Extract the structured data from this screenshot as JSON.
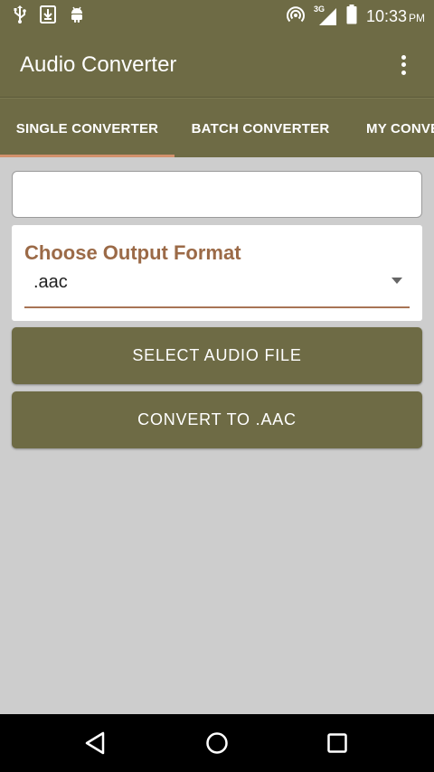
{
  "status_bar": {
    "time": "10:33",
    "ampm": "PM",
    "network": "3G",
    "icons": [
      "usb-icon",
      "download-icon",
      "android-icon",
      "hotspot-icon",
      "signal-icon",
      "battery-icon"
    ]
  },
  "app_bar": {
    "title": "Audio Converter",
    "menu_icon": "overflow-menu-icon"
  },
  "tabs": [
    {
      "label": "SINGLE CONVERTER",
      "active": true
    },
    {
      "label": "BATCH CONVERTER",
      "active": false
    },
    {
      "label": "MY CONVERTED",
      "active": false
    }
  ],
  "main": {
    "file_field_value": "",
    "output_format": {
      "title": "Choose Output Format",
      "selected": ".aac"
    },
    "select_button": "SELECT AUDIO FILE",
    "convert_button": "CONVERT TO .AAC"
  },
  "nav_bar": {
    "icons": [
      "back-icon",
      "home-icon",
      "recents-icon"
    ]
  },
  "colors": {
    "primary": "#6e6b45",
    "accent": "#d2916c",
    "title_text": "#9b6a47",
    "background": "#cdcdcd"
  }
}
